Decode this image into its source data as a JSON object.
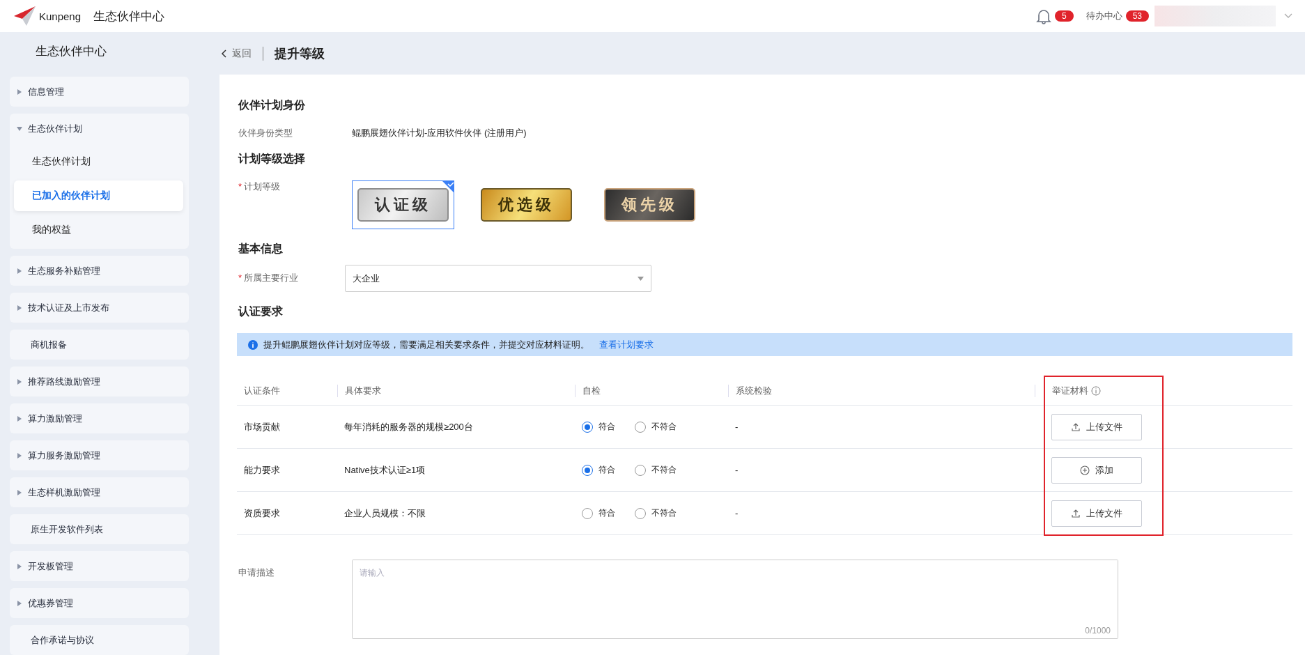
{
  "header": {
    "logo_text": "Kunpeng",
    "title": "生态伙伴中心",
    "notification_count": "5",
    "todo_label": "待办中心",
    "todo_count": "53"
  },
  "sidebar": {
    "title": "生态伙伴中心",
    "items": [
      {
        "label": "信息管理",
        "kind": "group",
        "expanded": false
      },
      {
        "label": "生态伙伴计划",
        "kind": "group",
        "expanded": true,
        "children": [
          {
            "label": "生态伙伴计划",
            "selected": false
          },
          {
            "label": "已加入的伙伴计划",
            "selected": true
          },
          {
            "label": "我的权益",
            "selected": false
          }
        ]
      },
      {
        "label": "生态服务补贴管理",
        "kind": "group",
        "expanded": false
      },
      {
        "label": "技术认证及上市发布",
        "kind": "group",
        "expanded": false
      },
      {
        "label": "商机报备",
        "kind": "link"
      },
      {
        "label": "推荐路线激励管理",
        "kind": "group",
        "expanded": false
      },
      {
        "label": "算力激励管理",
        "kind": "group",
        "expanded": false
      },
      {
        "label": "算力服务激励管理",
        "kind": "group",
        "expanded": false
      },
      {
        "label": "生态样机激励管理",
        "kind": "group",
        "expanded": false
      },
      {
        "label": "原生开发软件列表",
        "kind": "link"
      },
      {
        "label": "开发板管理",
        "kind": "group",
        "expanded": false
      },
      {
        "label": "优惠券管理",
        "kind": "group",
        "expanded": false
      },
      {
        "label": "合作承诺与协议",
        "kind": "link"
      }
    ]
  },
  "page": {
    "back": "返回",
    "title": "提升等级"
  },
  "identity": {
    "heading": "伙伴计划身份",
    "label": "伙伴身份类型",
    "value": "鲲鹏展翅伙伴计划-应用软件伙伴 (注册用户)"
  },
  "level_section": {
    "heading": "计划等级选择",
    "label": "计划等级",
    "required_mark": "*",
    "levels": [
      {
        "label": "认证级",
        "kind": "silver",
        "selected": true
      },
      {
        "label": "优选级",
        "kind": "gold",
        "selected": false
      },
      {
        "label": "领先级",
        "kind": "black",
        "selected": false
      }
    ]
  },
  "basic": {
    "heading": "基本信息",
    "label": "所属主要行业",
    "required_mark": "*",
    "value": "大企业"
  },
  "requirements": {
    "heading": "认证要求",
    "notice": "提升鲲鹏展翅伙伴计划对应等级，需要满足相关要求条件，并提交对应材料证明。",
    "notice_link": "查看计划要求",
    "columns": [
      "认证条件",
      "具体要求",
      "自检",
      "系统检验",
      "举证材料"
    ],
    "rows": [
      {
        "condition": "市场贡献",
        "requirement": "每年消耗的服务器的规模≥200台",
        "options": [
          {
            "label": "符合",
            "selected": true
          },
          {
            "label": "不符合",
            "selected": false
          }
        ],
        "system_check": "-",
        "evidence": {
          "kind": "upload",
          "label": "上传文件"
        }
      },
      {
        "condition": "能力要求",
        "requirement": "Native技术认证≥1项",
        "options": [
          {
            "label": "符合",
            "selected": true
          },
          {
            "label": "不符合",
            "selected": false
          }
        ],
        "system_check": "-",
        "evidence": {
          "kind": "add",
          "label": "添加"
        }
      },
      {
        "condition": "资质要求",
        "requirement": "企业人员规模：不限",
        "options": [
          {
            "label": "符合",
            "selected": false
          },
          {
            "label": "不符合",
            "selected": false
          }
        ],
        "system_check": "-",
        "evidence": {
          "kind": "upload",
          "label": "上传文件"
        }
      }
    ]
  },
  "description": {
    "label": "申请描述",
    "placeholder": "请输入",
    "counter": "0/1000"
  }
}
